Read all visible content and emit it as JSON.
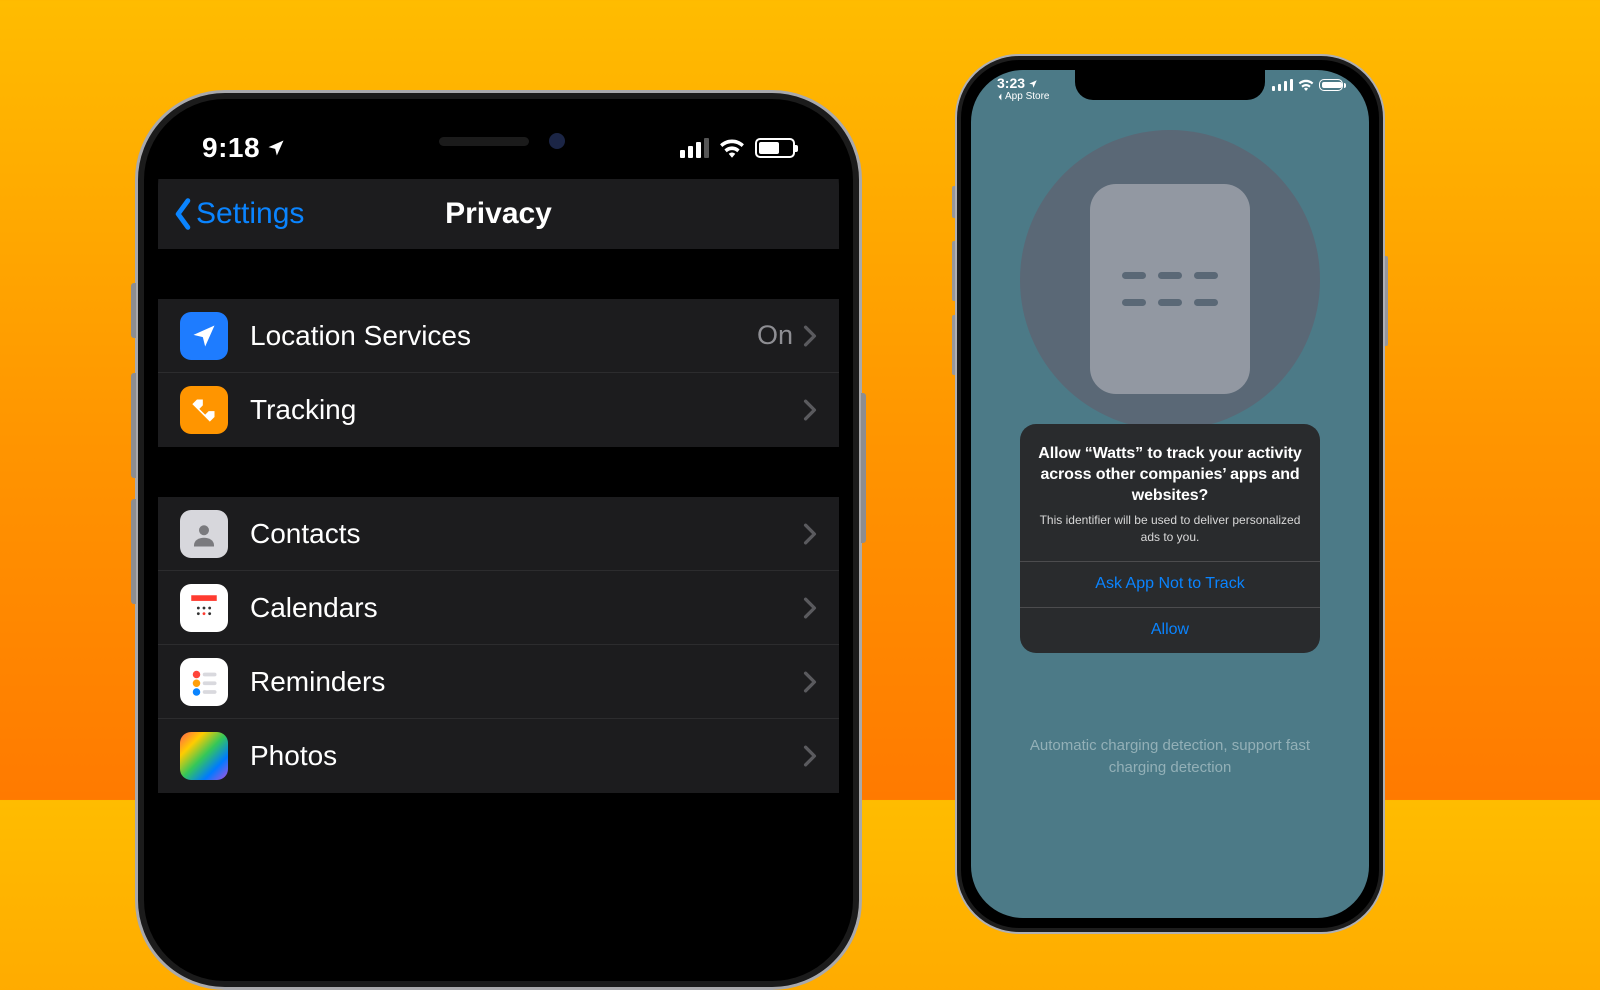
{
  "left": {
    "status_time": "9:18",
    "nav_back": "Settings",
    "nav_title": "Privacy",
    "group1": [
      {
        "label": "Location Services",
        "value": "On",
        "icon": "location-icon",
        "ic": "ic-loc"
      },
      {
        "label": "Tracking",
        "value": "",
        "icon": "tracking-icon",
        "ic": "ic-trk"
      }
    ],
    "group2": [
      {
        "label": "Contacts",
        "icon": "contacts-icon",
        "ic": "ic-con"
      },
      {
        "label": "Calendars",
        "icon": "calendars-icon",
        "ic": "ic-cal"
      },
      {
        "label": "Reminders",
        "icon": "reminders-icon",
        "ic": "ic-rem"
      },
      {
        "label": "Photos",
        "icon": "photos-icon",
        "ic": "ic-pho"
      }
    ]
  },
  "right": {
    "status_time": "3:23",
    "breadcrumb": "App Store",
    "alert_title": "Allow “Watts” to track your activity across other companies’ apps and websites?",
    "alert_message": "This identifier will be used to deliver personalized ads to you.",
    "alert_deny": "Ask App Not to Track",
    "alert_allow": "Allow",
    "caption": "Automatic charging detection, support fast charging detection"
  }
}
